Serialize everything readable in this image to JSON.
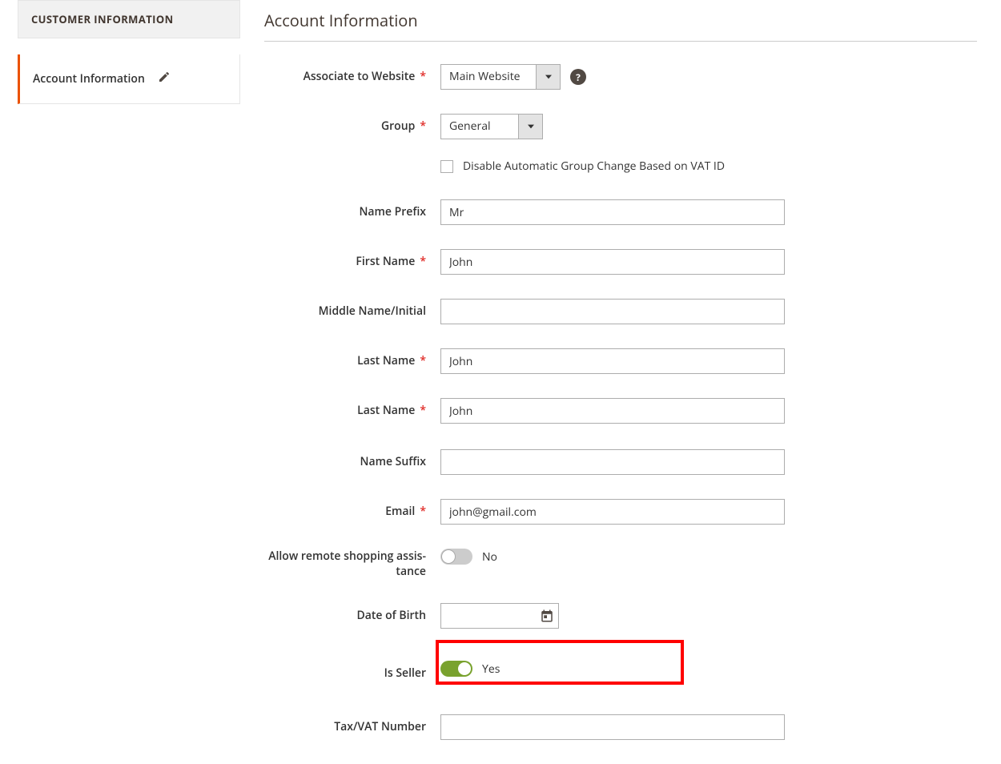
{
  "sidebar": {
    "header": "CUSTOMER INFORMATION",
    "item_label": "Account Information"
  },
  "section_title": "Account Information",
  "fields": {
    "associate": {
      "label": "Associate to Website",
      "required": true,
      "value": "Main Website"
    },
    "group": {
      "label": "Group",
      "required": true,
      "value": "General",
      "checkbox_label": "Disable Automatic Group Change Based on VAT ID"
    },
    "name_prefix": {
      "label": "Name Prefix",
      "value": "Mr"
    },
    "first_name": {
      "label": "First Name",
      "required": true,
      "value": "John"
    },
    "middle_name": {
      "label": "Middle Name/Initial",
      "value": ""
    },
    "last_name": {
      "label": "Last Name",
      "required": true,
      "value": "John"
    },
    "last_name2": {
      "label": "Last Name",
      "required": true,
      "value": "John"
    },
    "name_suffix": {
      "label": "Name Suffix",
      "value": ""
    },
    "email": {
      "label": "Email",
      "required": true,
      "value": "john@gmail.com"
    },
    "remote_assist": {
      "label": "Allow remote shopping assis­tance",
      "value": "No"
    },
    "dob": {
      "label": "Date of Birth",
      "value": ""
    },
    "is_seller": {
      "label": "Is Seller",
      "value": "Yes"
    },
    "tax_vat": {
      "label": "Tax/VAT Number",
      "value": ""
    }
  },
  "required_marker": "*"
}
